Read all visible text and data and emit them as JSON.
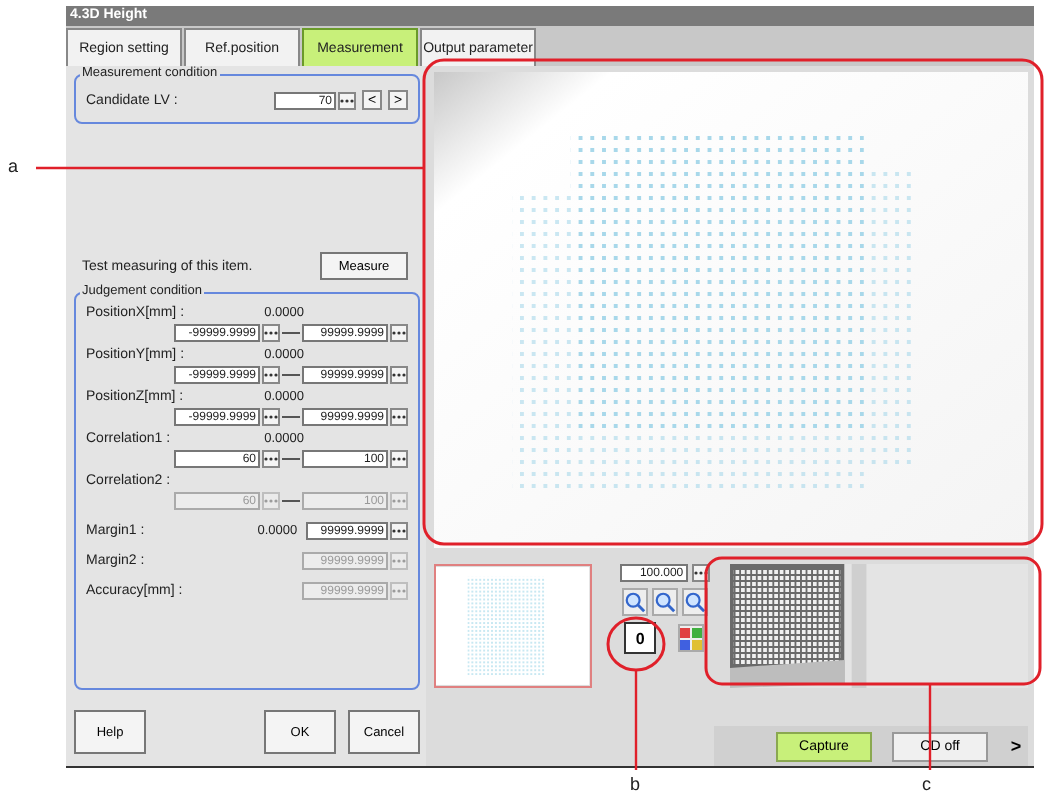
{
  "window": {
    "title": "4.3D Height"
  },
  "tabs": [
    {
      "label": "Region setting",
      "selected": false
    },
    {
      "label": "Ref.position",
      "selected": false
    },
    {
      "label": "Measurement",
      "selected": true
    },
    {
      "label": "Output parameter",
      "selected": false
    }
  ],
  "measurement_condition": {
    "title": "Measurement condition",
    "label": "Candidate LV :",
    "value": "70",
    "prev": "<",
    "next": ">"
  },
  "test": {
    "text": "Test measuring of this item.",
    "button": "Measure"
  },
  "judgement": {
    "title": "Judgement condition",
    "rows": [
      {
        "kind": "range",
        "label": "PositionX[mm] :",
        "value": "0.0000",
        "min": "-99999.9999",
        "max": "99999.9999",
        "disabled": false
      },
      {
        "kind": "range",
        "label": "PositionY[mm] :",
        "value": "0.0000",
        "min": "-99999.9999",
        "max": "99999.9999",
        "disabled": false
      },
      {
        "kind": "range",
        "label": "PositionZ[mm] :",
        "value": "0.0000",
        "min": "-99999.9999",
        "max": "99999.9999",
        "disabled": false
      },
      {
        "kind": "range",
        "label": "Correlation1 :",
        "value": "0.0000",
        "min": "60",
        "max": "100",
        "disabled": false
      },
      {
        "kind": "range",
        "label": "Correlation2 :",
        "min": "60",
        "max": "100",
        "disabled": true
      },
      {
        "kind": "single",
        "label": "Margin1 :",
        "value": "0.0000",
        "field": "99999.9999",
        "disabled": false
      },
      {
        "kind": "single",
        "label": "Margin2 :",
        "field": "99999.9999",
        "disabled": true
      },
      {
        "kind": "single",
        "label": "Accuracy[mm] :",
        "field": "99999.9999",
        "disabled": true
      }
    ]
  },
  "buttons": {
    "help": "Help",
    "ok": "OK",
    "cancel": "Cancel"
  },
  "zoom": {
    "value": "100.000"
  },
  "reset_button": "0",
  "bottom_bar": {
    "capture": "Capture",
    "cd_off": "CD off",
    "more": ">"
  },
  "callouts": [
    {
      "label": "a"
    },
    {
      "label": "b"
    },
    {
      "label": "c"
    }
  ]
}
